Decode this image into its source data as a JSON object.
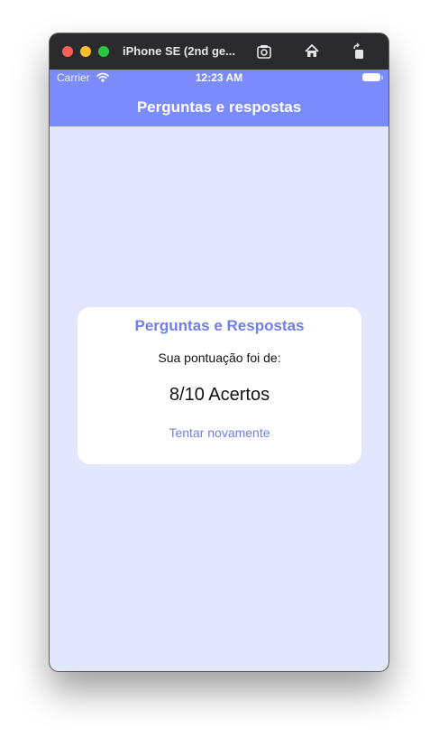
{
  "window": {
    "title": "iPhone SE (2nd ge...",
    "toolbar_icons": [
      "screenshot-icon",
      "home-icon",
      "rotate-icon"
    ]
  },
  "status_bar": {
    "carrier": "Carrier",
    "time": "12:23 AM"
  },
  "navbar": {
    "title": "Perguntas e respostas"
  },
  "result_card": {
    "title": "Perguntas e Respostas",
    "subtitle": "Sua pontuação foi de:",
    "score": "8/10 Acertos",
    "retry_label": "Tentar novamente"
  },
  "colors": {
    "navbar": "#7b8bfc",
    "background": "#e2e6fe",
    "accent": "#6f7fe3",
    "card": "#ffffff"
  }
}
